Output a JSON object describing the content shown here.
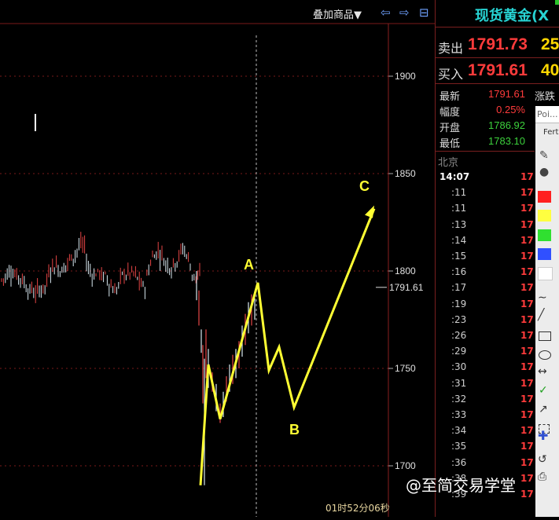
{
  "toolbar": {
    "overlay_label": "叠加商品▼",
    "prev_icon": "⇦",
    "next_icon": "⇨",
    "layout_icon": "⊟"
  },
  "quote": {
    "title": "现货黄金(X",
    "sell_label": "卖出",
    "sell_price": "1791.73",
    "sell_vol": "25",
    "buy_label": "买入",
    "buy_price": "1791.61",
    "buy_vol": "40",
    "latest_label": "最新",
    "latest_val": "1791.61",
    "change_label": "涨跌",
    "amplitude_label": "幅度",
    "amplitude_val": "0.25%",
    "open_label": "开盘",
    "open_val": "1786.92",
    "low_label": "最低",
    "low_val": "1783.10",
    "city": "北京"
  },
  "ticks": [
    {
      "time": "14:07",
      "price": "17"
    },
    {
      "time": ":11",
      "price": "17"
    },
    {
      "time": ":11",
      "price": "17"
    },
    {
      "time": ":13",
      "price": "17"
    },
    {
      "time": ":14",
      "price": "17"
    },
    {
      "time": ":15",
      "price": "17"
    },
    {
      "time": ":16",
      "price": "17"
    },
    {
      "time": ":17",
      "price": "17"
    },
    {
      "time": ":19",
      "price": "17"
    },
    {
      "time": ":23",
      "price": "17"
    },
    {
      "time": ":26",
      "price": "17"
    },
    {
      "time": ":29",
      "price": "17"
    },
    {
      "time": ":30",
      "price": "17"
    },
    {
      "time": ":31",
      "price": "17"
    },
    {
      "time": ":32",
      "price": "17"
    },
    {
      "time": ":33",
      "price": "17"
    },
    {
      "time": ":34",
      "price": "17"
    },
    {
      "time": ":35",
      "price": "17"
    },
    {
      "time": ":36",
      "price": "17"
    },
    {
      "time": ":38",
      "price": "17"
    },
    {
      "time": ":39",
      "price": "17"
    }
  ],
  "popup": {
    "top_text": "Poi...",
    "second_text": "Fert"
  },
  "chart_data": {
    "type": "line",
    "y_ticks": [
      1900,
      1850,
      1800,
      1750,
      1700
    ],
    "ylim": [
      1680,
      1935
    ],
    "current_price_label": "1791.61",
    "current_price": 1791.61,
    "wave_labels": [
      "A",
      "B",
      "C"
    ],
    "timer": "01时52分06秒",
    "colors": {
      "up": "#e54545",
      "down": "#d8e8f0",
      "wave": "#ffff33",
      "grid": "#7a1a1a"
    }
  },
  "watermark": "@至简交易学堂"
}
